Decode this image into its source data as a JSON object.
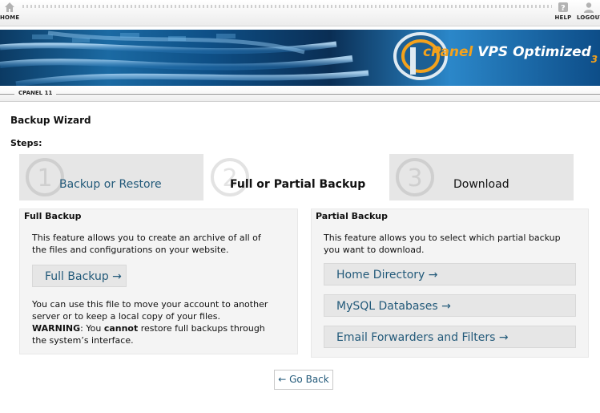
{
  "nav": {
    "home_label": "HOME",
    "help_label": "HELP",
    "logout_label": "LOGOUT"
  },
  "banner": {
    "brand_a": "cPanel",
    "brand_b": " VPS Optimized",
    "brand_c": "3"
  },
  "breadcrumb": {
    "label": "CPANEL 11"
  },
  "page": {
    "title": "Backup Wizard",
    "steps_label": "Steps:"
  },
  "steps": [
    {
      "number": "1",
      "label": "Backup or Restore"
    },
    {
      "number": "2",
      "label": "Full or Partial Backup"
    },
    {
      "number": "3",
      "label": "Download"
    }
  ],
  "full_backup": {
    "heading": "Full Backup",
    "description_line1": "This feature allows you to create an archive of all of",
    "description_line2": "the files and configurations on your website.",
    "button_label": "Full Backup →",
    "note_line1": "You can use this file to move your account to another",
    "note_line2": "server or to keep a local copy of your files.",
    "warning_label": "WARNING",
    "warning_pre": ": You ",
    "warning_cannot": "cannot",
    "warning_post": " restore full backups through",
    "note_line4": "the system’s interface."
  },
  "partial_backup": {
    "heading": "Partial Backup",
    "description_line1": "This feature allows you to select which partial backup",
    "description_line2": "you want to download.",
    "buttons": [
      {
        "label": "Home Directory →"
      },
      {
        "label": "MySQL Databases →"
      },
      {
        "label": "Email Forwarders and Filters →"
      }
    ]
  },
  "go_back_label": "← Go Back",
  "colors": {
    "link": "#235a7a",
    "step_bg": "#e6e6e6",
    "panel_bg": "#f4f4f4",
    "brand_orange": "#f4a21c"
  }
}
